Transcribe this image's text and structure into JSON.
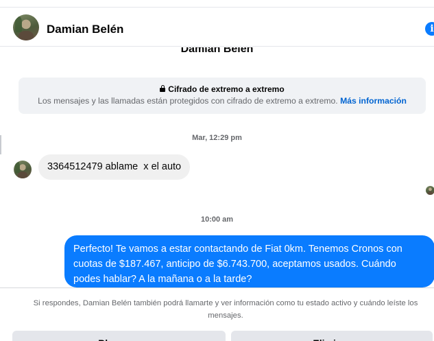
{
  "header": {
    "name": "Damian Belén",
    "info_icon": "i"
  },
  "thread": {
    "title": "Damian Belén",
    "encryption": {
      "title": "Cifrado de extremo a extremo",
      "text": "Los mensajes y las llamadas están protegidos con cifrado de extremo a extremo.",
      "link": "Más información"
    },
    "messages": [
      {
        "timestamp": "Mar, 12:29 pm",
        "direction": "incoming",
        "text": "3364512479 ablame  x el auto"
      },
      {
        "timestamp": "10:00 am",
        "direction": "outgoing",
        "text": "Perfecto! Te vamos a estar contactando de Fiat 0km. Tenemos Cronos con cuotas de $187.467, anticipo de $6.743.700, aceptamos usados. Cuándo podes hablar? A la mañana o a la tarde?"
      }
    ]
  },
  "footer": {
    "notice": "Si respondes, Damian Belén también podrá llamarte y ver información como tu estado activo y cuándo leíste los mensajes.",
    "block_label": "Bloquear",
    "delete_label": "Eliminar"
  },
  "colors": {
    "accent": "#0a7cff",
    "bubble_incoming": "#f0f0f0",
    "link": "#0064d1"
  }
}
